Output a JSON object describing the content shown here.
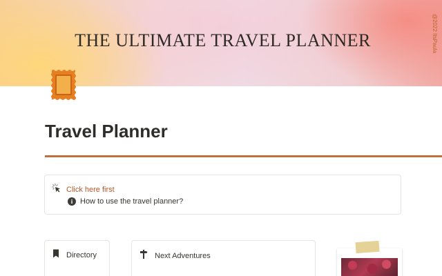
{
  "cover": {
    "title": "THE ULTIMATE TRAVEL PLANNER",
    "credit": "@2022 ItsPaula",
    "colors": {
      "warm_left": "#f7cf9a",
      "pink": "#f3d6d8",
      "coral_right": "#f2a9a4"
    }
  },
  "page": {
    "icon": "stamp-icon",
    "title": "Travel Planner",
    "accent_color": "#c0703a"
  },
  "callout": {
    "icon": "cursor-click-icon",
    "label": "Click here first",
    "link_icon": "info-icon",
    "link_label": "How to use the travel planner?"
  },
  "cards": {
    "directory": {
      "icon": "bookmark-icon",
      "label": "Directory"
    },
    "adventures": {
      "icon": "signpost-icon",
      "label": "Next Adventures"
    }
  },
  "photo": {
    "icon": "taped-photo"
  }
}
